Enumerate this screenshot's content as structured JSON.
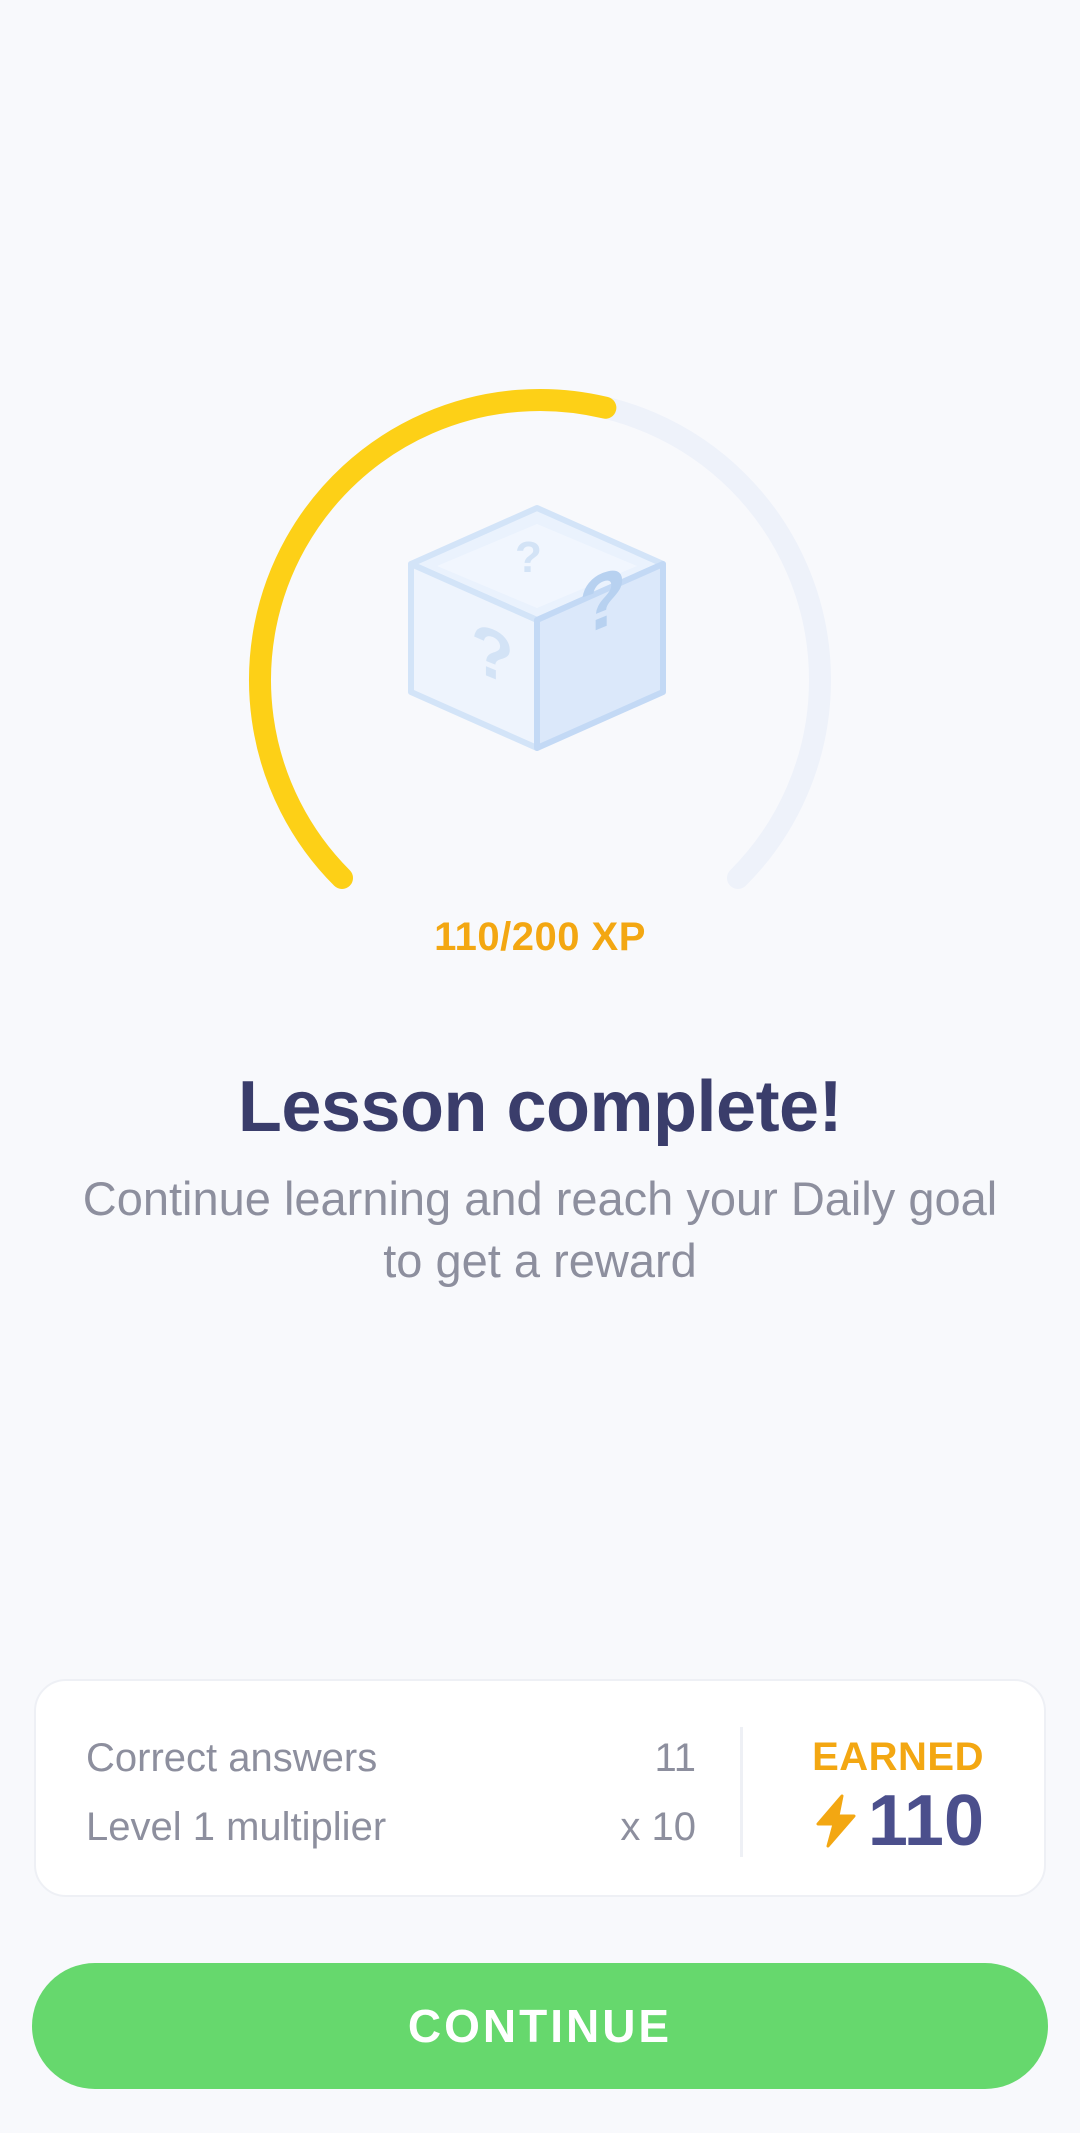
{
  "progress": {
    "current_xp": 110,
    "goal_xp": 200,
    "label": "110/200 XP",
    "reward_icon": "mystery-box-icon",
    "colors": {
      "fill": "#fdd017",
      "track": "#eef2fa",
      "label": "#f3a712"
    }
  },
  "lesson": {
    "title": "Lesson complete!",
    "subtitle": "Continue learning and reach your Daily goal to get a reward"
  },
  "summary": {
    "rows": [
      {
        "label": "Correct answers",
        "value": "11"
      },
      {
        "label": "Level 1 multiplier",
        "value": "x 10"
      }
    ],
    "earned_label": "EARNED",
    "earned_icon": "lightning-bolt-icon",
    "earned_value": "110"
  },
  "continue_label": "CONTINUE",
  "colors": {
    "background": "#f8f9fc",
    "title": "#3a3d6b",
    "muted_text": "#8d8f9e",
    "accent_orange": "#f3a712",
    "button_green": "#66d86d",
    "earned_value": "#4b4f8c"
  }
}
